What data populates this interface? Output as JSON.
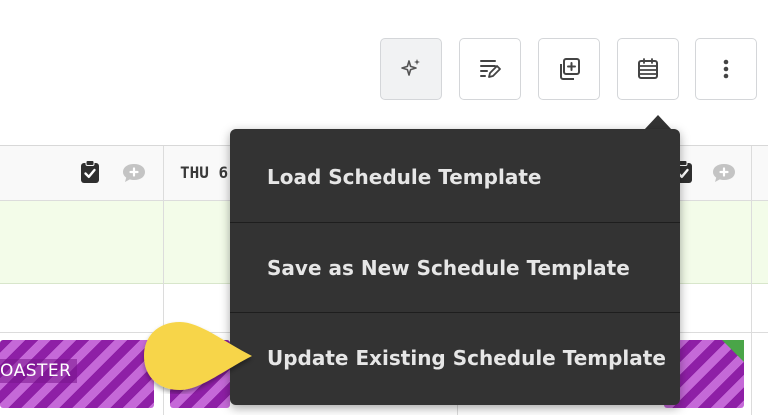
{
  "toolbar": {
    "buttons": [
      {
        "name": "ai-assist",
        "icon": "sparkle-icon"
      },
      {
        "name": "edit-notes",
        "icon": "edit-list-icon"
      },
      {
        "name": "duplicate",
        "icon": "copy-add-icon"
      },
      {
        "name": "schedule-template",
        "icon": "calendar-grid-icon"
      },
      {
        "name": "more",
        "icon": "more-vertical-icon"
      }
    ]
  },
  "grid": {
    "day_label": "THU 6"
  },
  "shifts": [
    {
      "label": "OASTER"
    },
    {
      "label": ""
    },
    {
      "label": ""
    }
  ],
  "template_menu": {
    "items": [
      {
        "label": "Load Schedule Template"
      },
      {
        "label": "Save as New Schedule Template"
      },
      {
        "label": "Update Existing Schedule Template"
      }
    ],
    "pointer_color": "#f7d548"
  },
  "colors": {
    "shift_purple": "#8e1fa6",
    "shift_stripe": "#c569d8",
    "green_row": "#f3fce9",
    "menu_bg": "#333333",
    "status_green": "#4aa548"
  }
}
